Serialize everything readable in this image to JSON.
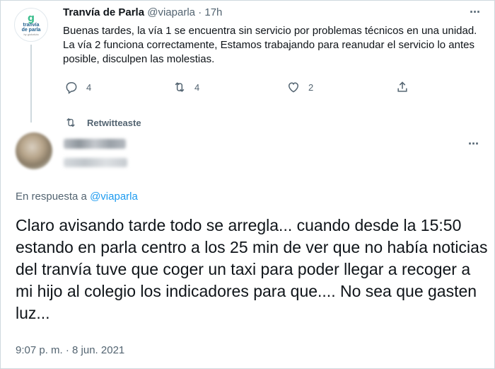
{
  "original_tweet": {
    "avatar": {
      "logo_mark": "g",
      "logo_line1": "tranvía",
      "logo_line2": "de parla",
      "logo_line3": "by globalvia"
    },
    "display_name": "Tranvía de Parla",
    "handle": "@viaparla",
    "separator": "·",
    "time": "17h",
    "text": "Buenas tardes, la vía 1 se encuentra sin servicio por problemas técnicos en una unidad. La vía 2 funciona correctamente, Estamos trabajando para reanudar el servicio lo antes posible, disculpen las molestias.",
    "more_icon": "more-horizontal-icon",
    "actions": {
      "reply": {
        "icon": "reply-icon",
        "count": "4"
      },
      "retweet": {
        "icon": "retweet-icon",
        "count": "4"
      },
      "like": {
        "icon": "like-icon",
        "count": "2"
      },
      "share": {
        "icon": "share-icon"
      }
    }
  },
  "retweet_banner": {
    "icon": "retweet-icon",
    "label": "Retwitteaste"
  },
  "reply_tweet": {
    "more_icon": "more-horizontal-icon",
    "reply_prefix": "En respuesta a ",
    "reply_mention": "@viaparla",
    "text": "Claro avisando tarde todo se arregla... cuando desde la 15:50 estando en parla centro a los 25 min de ver que no había noticias del tranvía tuve que coger un taxi para poder llegar a recoger a mi hijo al colegio los indicadores para que.... No sea que gasten luz...",
    "timestamp": "9:07 p. m. · 8 jun. 2021"
  },
  "colors": {
    "accent": "#1d9bf0",
    "secondary_text": "#536471",
    "primary_text": "#0f1419",
    "border": "#cfd9de"
  }
}
